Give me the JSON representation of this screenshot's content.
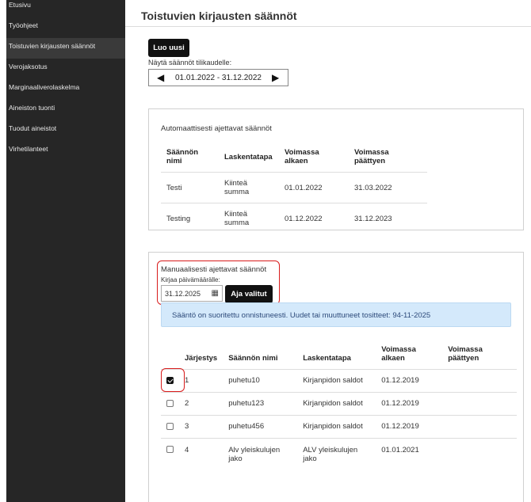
{
  "sidebar": {
    "items": [
      {
        "label": "Etusivu",
        "active": false
      },
      {
        "label": "Työohjeet",
        "active": false
      },
      {
        "label": "Toistuvien kirjausten säännöt",
        "active": true
      },
      {
        "label": "Verojaksotus",
        "active": false
      },
      {
        "label": "Marginaaliverolaskelma",
        "active": false
      },
      {
        "label": "Aineiston tuonti",
        "active": false
      },
      {
        "label": "Tuodut aineistot",
        "active": false
      },
      {
        "label": "Virhetilanteet",
        "active": false
      }
    ]
  },
  "page": {
    "title": "Toistuvien kirjausten säännöt",
    "new_button": "Luo uusi",
    "period_label": "Näytä säännöt tilikaudelle:",
    "period_value": "01.01.2022 - 31.12.2022"
  },
  "auto_rules": {
    "title": "Automaattisesti ajettavat säännöt",
    "columns": [
      "Säännön nimi",
      "Laskentatapa",
      "Voimassa alkaen",
      "Voimassa päättyen"
    ],
    "rows": [
      {
        "name": "Testi",
        "method": "Kiinteä summa",
        "start": "01.01.2022",
        "end": "31.03.2022"
      },
      {
        "name": "Testing",
        "method": "Kiinteä summa",
        "start": "01.12.2022",
        "end": "31.12.2023"
      }
    ]
  },
  "manual_rules": {
    "title": "Manuaalisesti ajettavat säännöt",
    "date_label": "Kirjaa päivämäärälle:",
    "date_value": "31.12.2025",
    "run_button": "Aja valitut",
    "alert": "Sääntö on suoritettu onnistuneesti. Uudet tai muuttuneet tositteet: 94-11-2025",
    "columns": [
      "",
      "Järjestys",
      "Säännön nimi",
      "Laskentatapa",
      "Voimassa alkaen",
      "Voimassa päättyen"
    ],
    "rows": [
      {
        "checked": true,
        "order": "1",
        "name": "puhetu10",
        "method": "Kirjanpidon saldot",
        "start": "01.12.2019",
        "end": ""
      },
      {
        "checked": false,
        "order": "2",
        "name": "puhetu123",
        "method": "Kirjanpidon saldot",
        "start": "01.12.2019",
        "end": ""
      },
      {
        "checked": false,
        "order": "3",
        "name": "puhetu456",
        "method": "Kirjanpidon saldot",
        "start": "01.12.2019",
        "end": ""
      },
      {
        "checked": false,
        "order": "4",
        "name": "Alv yleiskulujen jako",
        "method": "ALV yleiskulujen jako",
        "start": "01.01.2021",
        "end": ""
      }
    ]
  }
}
